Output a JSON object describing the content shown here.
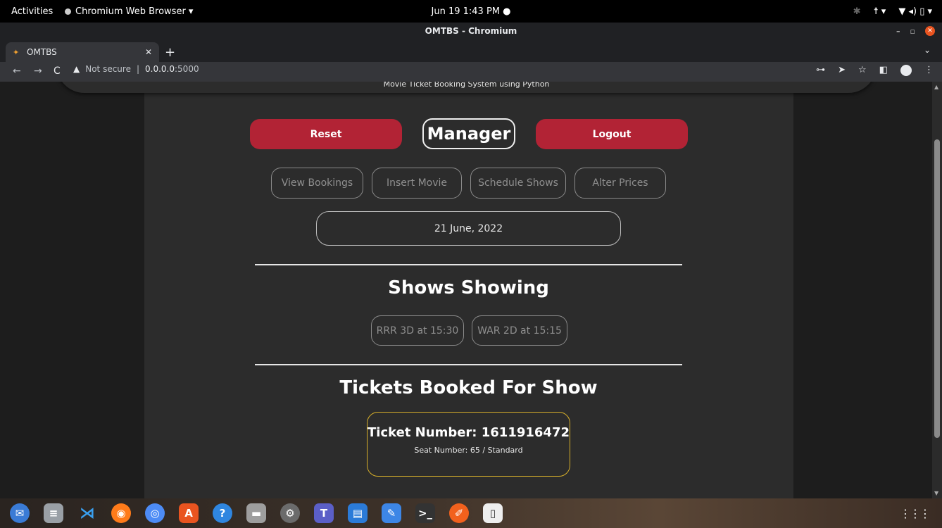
{
  "system_bar": {
    "activities": "Activities",
    "app_name": "Chromium Web Browser ▾",
    "clock": "Jun 19  1:43 PM  ●"
  },
  "window": {
    "title": "OMTBS - Chromium"
  },
  "tab": {
    "title": "OMTBS"
  },
  "address_bar": {
    "security": "Not secure",
    "host": "0.0.0.0",
    "port": ":5000"
  },
  "page": {
    "subtitle": "Movie Ticket Booking System using Python",
    "reset_label": "Reset",
    "role_title": "Manager",
    "logout_label": "Logout",
    "nav": [
      {
        "label": "View Bookings"
      },
      {
        "label": "Insert Movie"
      },
      {
        "label": "Schedule Shows"
      },
      {
        "label": "Alter Prices"
      }
    ],
    "date_value": "21 June, 2022",
    "shows_title": "Shows Showing",
    "shows": [
      {
        "label": "RRR 3D at 15:30"
      },
      {
        "label": "WAR 2D at 15:15"
      }
    ],
    "tickets_title": "Tickets Booked For Show",
    "ticket": {
      "number_line": "Ticket Number: 1611916472",
      "seat_line": "Seat Number: 65 / Standard"
    }
  },
  "colors": {
    "accent_red": "#b22335",
    "ticket_border": "#d8b02a",
    "panel_bg": "#2c2c2c"
  },
  "icons": [
    "back-icon",
    "forward-icon",
    "reload-icon",
    "warning-icon",
    "key-icon",
    "send-icon",
    "star-icon",
    "sidepanel-icon",
    "profile-icon",
    "menu-icon"
  ]
}
